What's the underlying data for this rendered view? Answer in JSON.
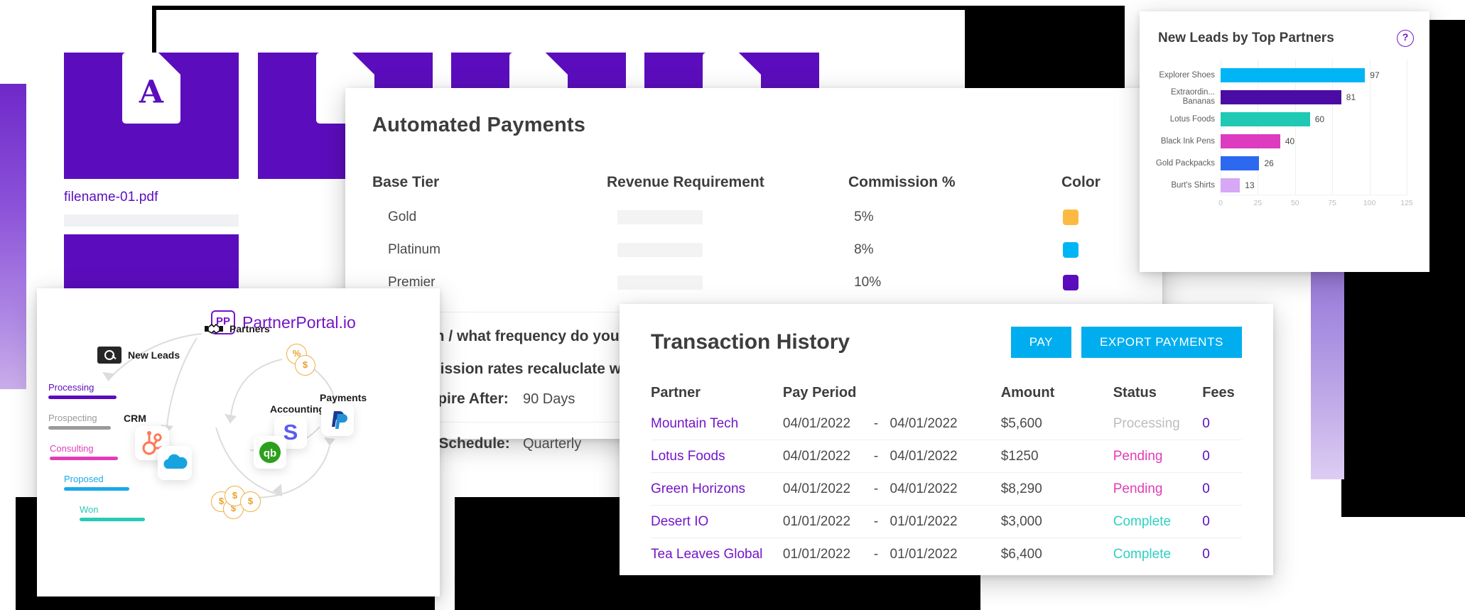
{
  "files_panel": {
    "tiles": [
      {
        "name": "filename-01.pdf",
        "icon": "pdf-file-icon"
      },
      {
        "name": "",
        "icon": "file-icon"
      },
      {
        "name": "",
        "icon": "file-icon"
      },
      {
        "name": "",
        "icon": "file-icon"
      }
    ]
  },
  "automated_payments": {
    "title": "Automated Payments",
    "columns": [
      "Base Tier",
      "Revenue Requirement",
      "Commission %",
      "Color"
    ],
    "rows": [
      {
        "tier": "Gold",
        "revenue": "",
        "commission": "5%",
        "color": "#FBBB42"
      },
      {
        "tier": "Platinum",
        "revenue": "",
        "commission": "8%",
        "color": "#00B5F5"
      },
      {
        "tier": "Premier",
        "revenue": "",
        "commission": "10%",
        "color": "#5B0DBD"
      }
    ],
    "question_1": "How often / what frequency do you calculate tiers",
    "question_2": "Do commission rates recaluclate with tier",
    "field_expire_label": "Leads Expire After:",
    "field_expire_value": "90 Days",
    "field_schedule_label": "Payment Schedule:",
    "field_schedule_value": "Quarterly"
  },
  "leads_chart": {
    "title": "New Leads by Top Partners",
    "help_icon": "help-circle-icon",
    "chart_data": {
      "type": "bar",
      "orientation": "horizontal",
      "title": "New Leads by Top Partners",
      "xlabel": "",
      "ylabel": "",
      "categories": [
        "Explorer Shoes",
        "Extraordin... Bananas",
        "Lotus Foods",
        "Black Ink Pens",
        "Gold Packpacks",
        "Burt's Shirts"
      ],
      "values": [
        97,
        81,
        60,
        40,
        26,
        13
      ],
      "colors": [
        "#00B5F5",
        "#4B0BA5",
        "#1FC9B4",
        "#DD3CC0",
        "#2D68F0",
        "#D6A8F5"
      ],
      "xticks": [
        0,
        25,
        50,
        75,
        100,
        125
      ],
      "xlim": [
        0,
        125
      ],
      "grid": true,
      "legend": false,
      "data_labels": [
        "97",
        "81",
        "60",
        "40",
        "26",
        "13"
      ]
    }
  },
  "diagram": {
    "brand_badge": "PP",
    "brand_name": "PartnerPortal.io",
    "nodes": [
      {
        "label": "Partners",
        "icon": "handshake-icon"
      },
      {
        "label": "New Leads",
        "icon": "search-icon"
      },
      {
        "label": "CRM",
        "icon": "crm-group-icon"
      },
      {
        "label": "Accounting",
        "icon": "accounting-group-icon"
      },
      {
        "label": "Payments",
        "icon": "paypal-icon"
      }
    ],
    "stage_bars": [
      {
        "label": "Processing",
        "color": "#5B0DBD",
        "width": 96
      },
      {
        "label": "Prospecting",
        "color": "#9a9a9a",
        "width": 88
      },
      {
        "label": "Consulting",
        "color": "#E23CB8",
        "width": 96
      },
      {
        "label": "Proposed",
        "color": "#19A8E8",
        "width": 92
      },
      {
        "label": "Won",
        "color": "#25CCB4",
        "width": 92
      }
    ],
    "coin_symbols": [
      "%",
      "$",
      "$",
      "$",
      "$",
      "$"
    ],
    "crm_icons": [
      "hubspot-icon",
      "salesforce-cloud-icon"
    ],
    "accounting_icons": [
      "stripe-icon",
      "quickbooks-icon"
    ]
  },
  "transactions": {
    "title": "Transaction History",
    "pay_label": "PAY",
    "export_label": "EXPORT PAYMENTS",
    "columns": [
      "Partner",
      "Pay Period",
      "Amount",
      "Status",
      "Fees"
    ],
    "rows": [
      {
        "partner": "Mountain Tech",
        "start": "04/01/2022",
        "dash": "-",
        "end": "04/01/2022",
        "amount": "$5,600",
        "status": "Processing",
        "status_color": "#bdbdbd",
        "fees": "0"
      },
      {
        "partner": "Lotus Foods",
        "start": "04/01/2022",
        "dash": "-",
        "end": "04/01/2022",
        "amount": "$1250",
        "status": "Pending",
        "status_color": "#E23CB8",
        "fees": "0"
      },
      {
        "partner": "Green Horizons",
        "start": "04/01/2022",
        "dash": "-",
        "end": "04/01/2022",
        "amount": "$8,290",
        "status": "Pending",
        "status_color": "#E23CB8",
        "fees": "0"
      },
      {
        "partner": "Desert IO",
        "start": "01/01/2022",
        "dash": "-",
        "end": "01/01/2022",
        "amount": "$3,000",
        "status": "Complete",
        "status_color": "#2ED0C2",
        "fees": "0"
      },
      {
        "partner": "Tea Leaves Global",
        "start": "01/01/2022",
        "dash": "-",
        "end": "01/01/2022",
        "amount": "$6,400",
        "status": "Complete",
        "status_color": "#2ED0C2",
        "fees": "0"
      }
    ]
  },
  "theme": {
    "brand_purple": "#5B0DBD",
    "link_purple": "#7315c9",
    "accent_blue": "#00AEEF"
  }
}
